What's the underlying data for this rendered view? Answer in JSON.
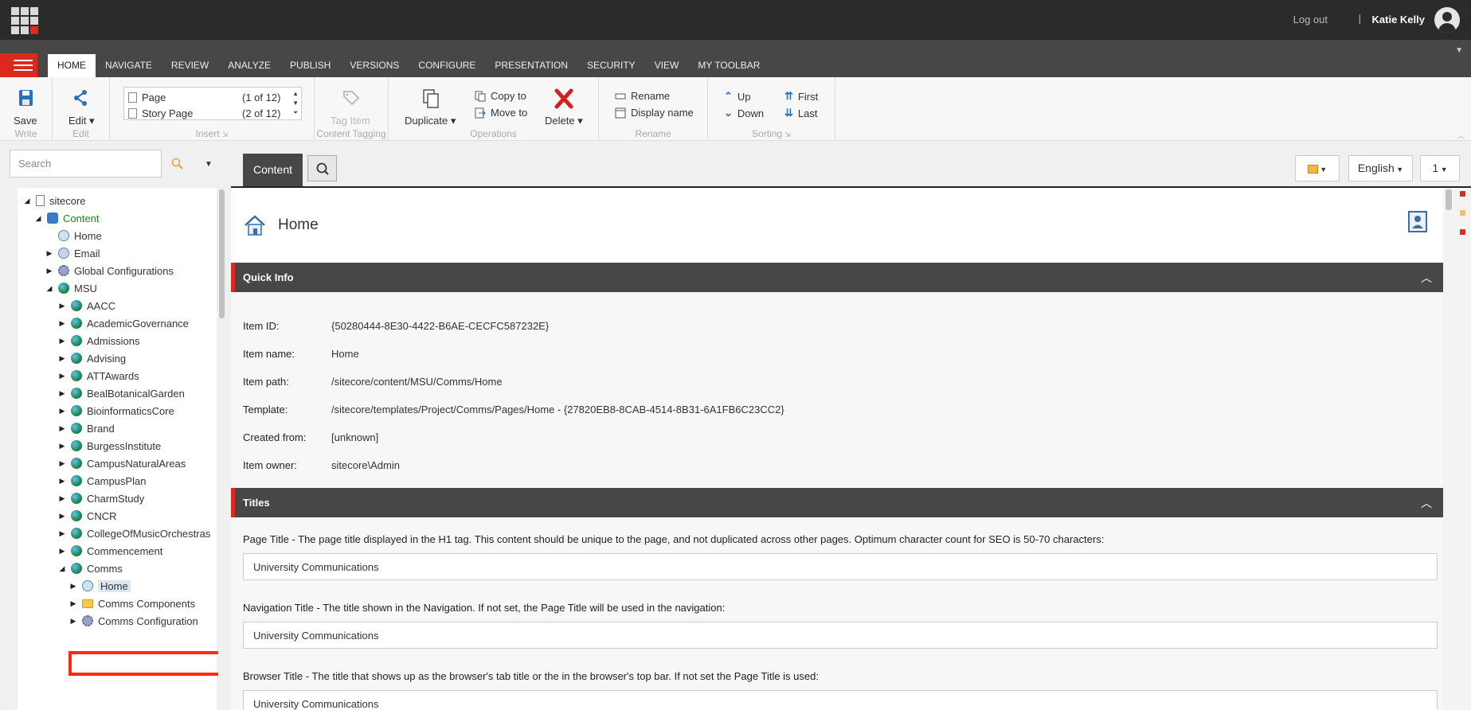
{
  "topbar": {
    "logout": "Log out",
    "separator": "|",
    "user": "Katie Kelly"
  },
  "tabs": [
    "HOME",
    "NAVIGATE",
    "REVIEW",
    "ANALYZE",
    "PUBLISH",
    "VERSIONS",
    "CONFIGURE",
    "PRESENTATION",
    "SECURITY",
    "VIEW",
    "MY TOOLBAR"
  ],
  "ribbon": {
    "write": {
      "save": "Save",
      "label": "Write"
    },
    "edit": {
      "edit": "Edit",
      "label": "Edit"
    },
    "insert": {
      "label": "Insert",
      "items": [
        {
          "name": "Page",
          "count": "(1 of 12)"
        },
        {
          "name": "Story Page",
          "count": "(2 of 12)"
        }
      ]
    },
    "tagging": {
      "tag_item": "Tag Item",
      "label": "Content Tagging"
    },
    "operations": {
      "duplicate": "Duplicate",
      "copy_to": "Copy to",
      "move_to": "Move to",
      "delete": "Delete",
      "label": "Operations"
    },
    "rename": {
      "rename": "Rename",
      "display_name": "Display name",
      "label": "Rename"
    },
    "sorting": {
      "up": "Up",
      "down": "Down",
      "first": "First",
      "last": "Last",
      "label": "Sorting"
    }
  },
  "search": {
    "placeholder": "Search"
  },
  "tree": {
    "sitecore": "sitecore",
    "content": "Content",
    "home": "Home",
    "email": "Email",
    "global": "Global Configurations",
    "msu": "MSU",
    "msu_children": [
      "AACC",
      "AcademicGovernance",
      "Admissions",
      "Advising",
      "ATTAwards",
      "BealBotanicalGarden",
      "BioinformaticsCore",
      "Brand",
      "BurgessInstitute",
      "CampusNaturalAreas",
      "CampusPlan",
      "CharmStudy",
      "CNCR",
      "CollegeOfMusicOrchestras",
      "Commencement",
      "Comms"
    ],
    "comms_children": [
      "Home",
      "Comms Components",
      "Comms Configuration"
    ]
  },
  "editor": {
    "content_tab": "Content",
    "language": "English",
    "version": "1",
    "item_title": "Home",
    "quick_info": {
      "title": "Quick Info",
      "rows": [
        {
          "label": "Item ID:",
          "value": "{50280444-8E30-4422-B6AE-CECFC587232E}"
        },
        {
          "label": "Item name:",
          "value": "Home"
        },
        {
          "label": "Item path:",
          "value": "/sitecore/content/MSU/Comms/Home"
        },
        {
          "label": "Template:",
          "value": "/sitecore/templates/Project/Comms/Pages/Home - {27820EB8-8CAB-4514-8B31-6A1FB6C23CC2}"
        },
        {
          "label": "Created from:",
          "value": "[unknown]"
        },
        {
          "label": "Item owner:",
          "value": "sitecore\\Admin"
        }
      ]
    },
    "titles": {
      "title": "Titles",
      "fields": [
        {
          "label": "Page Title - The page title displayed in the H1 tag. This content should be unique to the page, and not duplicated across other pages. Optimum character count for SEO is 50-70 characters:",
          "value": "University Communications"
        },
        {
          "label": "Navigation Title - The title shown in the Navigation. If not set, the Page Title will be used in the navigation:",
          "value": "University Communications"
        },
        {
          "label": "Browser Title - The title that shows up as the browser's tab title or the in the browser's top bar. If not set the Page Title is used:",
          "value": "University Communications"
        }
      ]
    }
  }
}
